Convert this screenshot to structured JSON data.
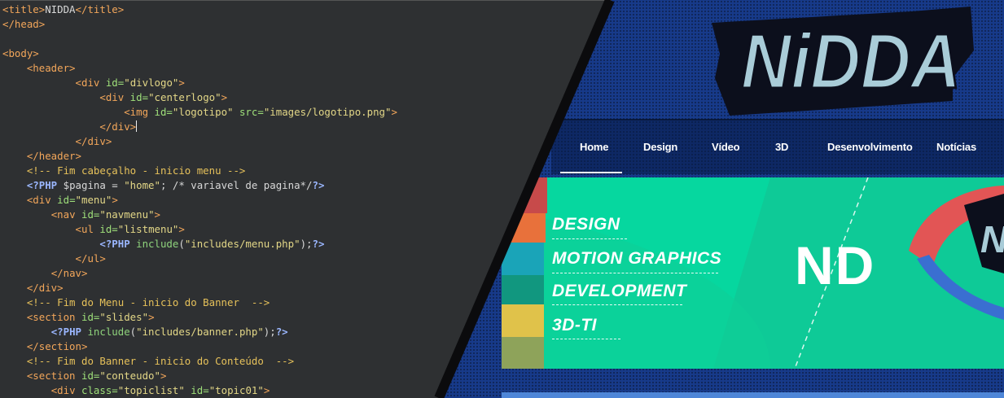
{
  "editor": {
    "lines": [
      [
        [
          "t",
          "<title>"
        ],
        [
          "v",
          "NIDDA"
        ],
        [
          "t",
          "</title>"
        ]
      ],
      [
        [
          "t",
          "</head>"
        ]
      ],
      [],
      [
        [
          "t",
          "<body>"
        ]
      ],
      [
        [
          "v",
          "    "
        ],
        [
          "t",
          "<header>"
        ]
      ],
      [
        [
          "v",
          "            "
        ],
        [
          "t",
          "<div "
        ],
        [
          "a",
          "id="
        ],
        [
          "s",
          "\"divlogo\""
        ],
        [
          "t",
          ">"
        ]
      ],
      [
        [
          "v",
          "                "
        ],
        [
          "t",
          "<div "
        ],
        [
          "a",
          "id="
        ],
        [
          "s",
          "\"centerlogo\""
        ],
        [
          "t",
          ">"
        ]
      ],
      [
        [
          "v",
          "                    "
        ],
        [
          "t",
          "<img "
        ],
        [
          "a",
          "id="
        ],
        [
          "s",
          "\"logotipo\" "
        ],
        [
          "a",
          "src="
        ],
        [
          "s",
          "\"images/logotipo.png\""
        ],
        [
          "t",
          ">"
        ]
      ],
      [
        [
          "v",
          "                "
        ],
        [
          "t",
          "</div>"
        ],
        [
          "cursor",
          ""
        ]
      ],
      [
        [
          "v",
          "            "
        ],
        [
          "t",
          "</div>"
        ]
      ],
      [
        [
          "v",
          "    "
        ],
        [
          "t",
          "</header>"
        ]
      ],
      [
        [
          "v",
          "    "
        ],
        [
          "c",
          "<!-- Fim cabeçalho - inicio menu -->"
        ]
      ],
      [
        [
          "v",
          "    "
        ],
        [
          "php",
          "<?PHP "
        ],
        [
          "v",
          "$pagina = "
        ],
        [
          "s",
          "\"home\""
        ],
        [
          "v",
          "; /* variavel de pagina*/"
        ],
        [
          "php",
          "?>"
        ]
      ],
      [
        [
          "v",
          "    "
        ],
        [
          "t",
          "<div "
        ],
        [
          "a",
          "id="
        ],
        [
          "s",
          "\"menu\""
        ],
        [
          "t",
          ">"
        ]
      ],
      [
        [
          "v",
          "        "
        ],
        [
          "t",
          "<nav "
        ],
        [
          "a",
          "id="
        ],
        [
          "s",
          "\"navmenu\""
        ],
        [
          "t",
          ">"
        ]
      ],
      [
        [
          "v",
          "            "
        ],
        [
          "t",
          "<ul "
        ],
        [
          "a",
          "id="
        ],
        [
          "s",
          "\"listmenu\""
        ],
        [
          "t",
          ">"
        ]
      ],
      [
        [
          "v",
          "                "
        ],
        [
          "php",
          "<?PHP "
        ],
        [
          "kw",
          "include"
        ],
        [
          "v",
          "("
        ],
        [
          "s",
          "\"includes/menu.php\""
        ],
        [
          "v",
          ");"
        ],
        [
          "php",
          "?>"
        ]
      ],
      [
        [
          "v",
          "            "
        ],
        [
          "t",
          "</ul>"
        ]
      ],
      [
        [
          "v",
          "        "
        ],
        [
          "t",
          "</nav>"
        ]
      ],
      [
        [
          "v",
          "    "
        ],
        [
          "t",
          "</div>"
        ]
      ],
      [
        [
          "v",
          "    "
        ],
        [
          "c",
          "<!-- Fim do Menu - inicio do Banner  -->"
        ]
      ],
      [
        [
          "v",
          "    "
        ],
        [
          "t",
          "<section "
        ],
        [
          "a",
          "id="
        ],
        [
          "s",
          "\"slides\""
        ],
        [
          "t",
          ">"
        ]
      ],
      [
        [
          "v",
          "        "
        ],
        [
          "php",
          "<?PHP "
        ],
        [
          "kw",
          "include"
        ],
        [
          "v",
          "("
        ],
        [
          "s",
          "\"includes/banner.php\""
        ],
        [
          "v",
          ");"
        ],
        [
          "php",
          "?>"
        ]
      ],
      [
        [
          "v",
          "    "
        ],
        [
          "t",
          "</section>"
        ]
      ],
      [
        [
          "v",
          "    "
        ],
        [
          "c",
          "<!-- Fim do Banner - inicio do Conteúdo  -->"
        ]
      ],
      [
        [
          "v",
          "    "
        ],
        [
          "t",
          "<section "
        ],
        [
          "a",
          "id="
        ],
        [
          "s",
          "\"conteudo\""
        ],
        [
          "t",
          ">"
        ]
      ],
      [
        [
          "v",
          "        "
        ],
        [
          "t",
          "<div "
        ],
        [
          "a",
          "class="
        ],
        [
          "s",
          "\"topiclist\" "
        ],
        [
          "a",
          "id="
        ],
        [
          "s",
          "\"topic01\""
        ],
        [
          "t",
          ">"
        ]
      ]
    ]
  },
  "site": {
    "logo_text": "NiDDA",
    "nav": [
      "Home",
      "Design",
      "Vídeo",
      "3D",
      "Desenvolvimento",
      "Notícias"
    ],
    "active_nav": "Home",
    "banner": {
      "items": [
        "DESIGN",
        "MOTION GRAPHICS",
        "DEVELOPMENT",
        "3D-TI"
      ],
      "mark": "ND"
    }
  },
  "colors": {
    "editor_bg": "#2e3032",
    "site_bg": "#173a8a",
    "banner_green": "#06d79f",
    "nav_text": "#ffffff"
  }
}
